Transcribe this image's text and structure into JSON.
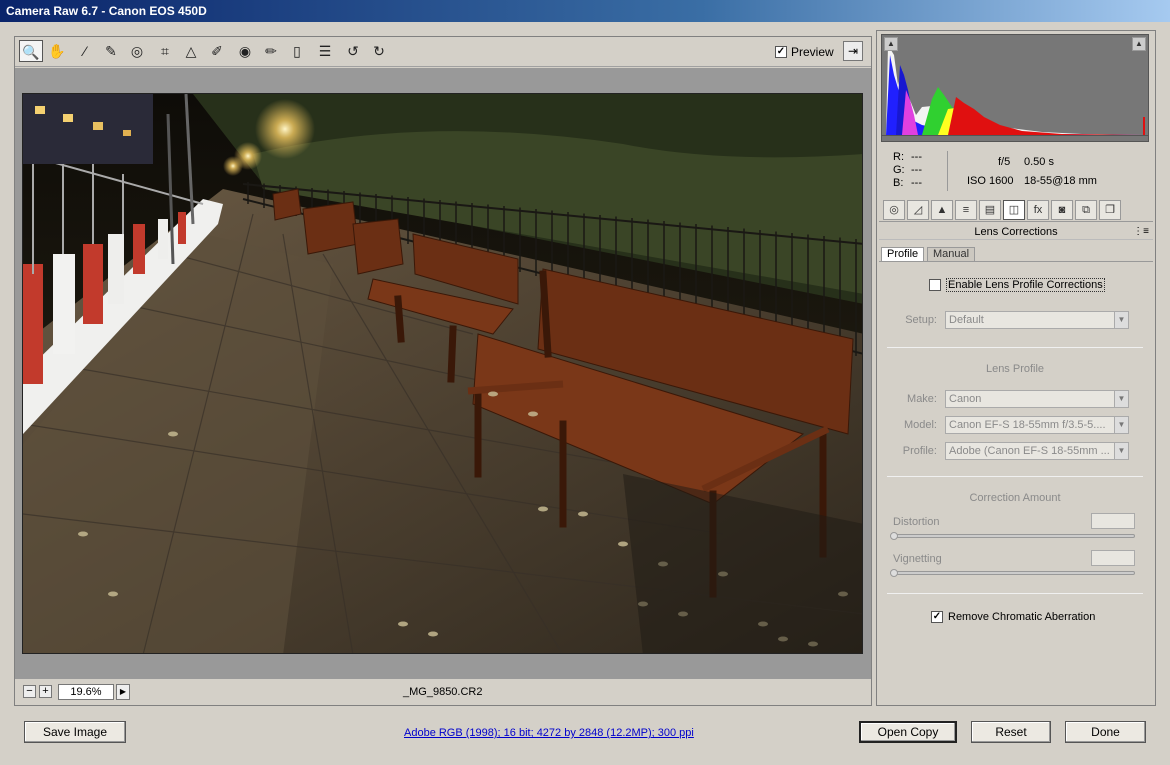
{
  "window": {
    "title": "Camera Raw 6.7  -  Canon EOS 450D"
  },
  "toolbar": {
    "tools": [
      {
        "name": "zoom-tool",
        "icon": "🔍"
      },
      {
        "name": "hand-tool",
        "icon": "✋"
      },
      {
        "name": "white-balance-tool",
        "icon": "⁄"
      },
      {
        "name": "color-sampler-tool",
        "icon": "✎"
      },
      {
        "name": "targeted-adjustment-tool",
        "icon": "◎"
      },
      {
        "name": "crop-tool",
        "icon": "⌗"
      },
      {
        "name": "straighten-tool",
        "icon": "△"
      },
      {
        "name": "spot-removal-tool",
        "icon": "✐"
      },
      {
        "name": "red-eye-tool",
        "icon": "◉"
      },
      {
        "name": "adjustment-brush-tool",
        "icon": "✏"
      },
      {
        "name": "graduated-filter-tool",
        "icon": "▯"
      },
      {
        "name": "preferences-tool",
        "icon": "☰"
      },
      {
        "name": "rotate-left-tool",
        "icon": "↺"
      },
      {
        "name": "rotate-right-tool",
        "icon": "↻"
      }
    ],
    "preview_label": "Preview",
    "preview_checked": "✓",
    "fullscreen_icon": "⇥"
  },
  "status": {
    "zoom": "19.6%",
    "filename": "_MG_9850.CR2",
    "zoom_out": "−",
    "zoom_in": "+",
    "zoom_dd": "▶"
  },
  "info": {
    "r": "R:",
    "g": "G:",
    "b": "B:",
    "r_val": "---",
    "g_val": "---",
    "b_val": "---",
    "aperture": "f/5",
    "shutter": "0.50 s",
    "iso": "ISO 1600",
    "lens": "18-55@18 mm"
  },
  "panel": {
    "tabs": [
      "◎",
      "◿",
      "▲",
      "≡",
      "▤",
      "◫",
      "fx",
      "◙",
      "⧉",
      "❐"
    ],
    "title": "Lens Corrections",
    "menu_icon": "⋮≡",
    "subtabs": [
      "Profile",
      "Manual"
    ],
    "enable_label": "Enable Lens Profile Corrections",
    "setup_label": "Setup:",
    "setup_value": "Default",
    "lens_profile_title": "Lens Profile",
    "make_label": "Make:",
    "make_value": "Canon",
    "model_label": "Model:",
    "model_value": "Canon EF-S 18-55mm f/3.5-5....",
    "profile_label": "Profile:",
    "profile_value": "Adobe (Canon EF-S 18-55mm ...",
    "correction_title": "Correction Amount",
    "distortion_label": "Distortion",
    "vignetting_label": "Vignetting",
    "ca_label": "Remove Chromatic Aberration",
    "ca_checked": "✓"
  },
  "buttons": {
    "save": "Save Image",
    "open": "Open Copy",
    "reset": "Reset",
    "done": "Done"
  },
  "workflow_link": "Adobe RGB (1998); 16 bit; 4272 by 2848 (12.2MP); 300 ppi"
}
